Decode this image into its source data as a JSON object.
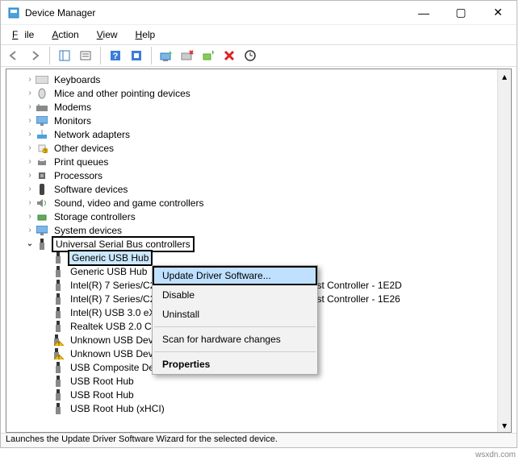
{
  "window": {
    "title": "Device Manager"
  },
  "menu": {
    "file": "File",
    "action": "Action",
    "view": "View",
    "help": "Help"
  },
  "tree": {
    "keyboards": "Keyboards",
    "mice": "Mice and other pointing devices",
    "modems": "Modems",
    "monitors": "Monitors",
    "network": "Network adapters",
    "other": "Other devices",
    "print": "Print queues",
    "processors": "Processors",
    "software": "Software devices",
    "sound": "Sound, video and game controllers",
    "storage": "Storage controllers",
    "system": "System devices",
    "usb": "Universal Serial Bus controllers",
    "usb_children": {
      "generic1": "Generic USB Hub",
      "generic2": "Generic USB Hub",
      "intel1": "Intel(R) 7 Series/C216 Chipset Family USB Enhanced Host Controller - 1E2D",
      "intel2": "Intel(R) 7 Series/C216 Chipset Family USB Enhanced Host Controller - 1E26",
      "intel3": "Intel(R) USB 3.0 eXtensible Host Controller",
      "realtek": "Realtek USB 2.0 Card Reader",
      "unk1": "Unknown USB Device",
      "unk2": "Unknown USB Device",
      "composite": "USB Composite Device",
      "roothub1": "USB Root Hub",
      "roothub2": "USB Root Hub",
      "roothubx": "USB Root Hub (xHCI)"
    }
  },
  "context_menu": {
    "update": "Update Driver Software...",
    "disable": "Disable",
    "uninstall": "Uninstall",
    "scan": "Scan for hardware changes",
    "properties": "Properties"
  },
  "status": "Launches the Update Driver Software Wizard for the selected device.",
  "watermark": "wsxdn.com"
}
